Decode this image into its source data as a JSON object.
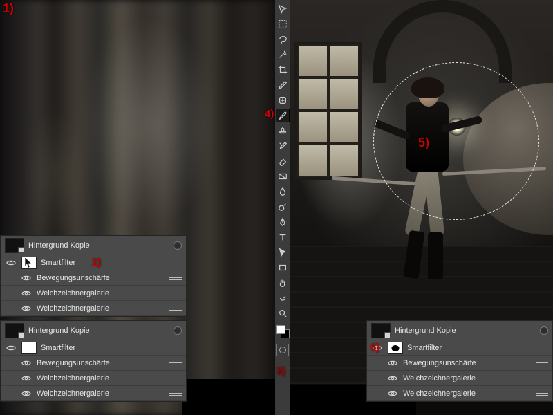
{
  "markers": {
    "m1": "1)",
    "m2": "2)",
    "m3": "3)",
    "m4": "4)",
    "m5": "5)",
    "m6": "6)"
  },
  "layerPanels": {
    "leftTop": {
      "header": "Hintergrund Kopie",
      "smartfilter": "Smartfilter",
      "filters": [
        "Bewegungsunschärfe",
        "Weichzeichnergalerie",
        "Weichzeichnergalerie"
      ]
    },
    "leftBottom": {
      "header": "Hintergrund Kopie",
      "smartfilter": "Smartfilter",
      "filters": [
        "Bewegungsunschärfe",
        "Weichzeichnergalerie",
        "Weichzeichnergalerie"
      ]
    },
    "right": {
      "header": "Hintergrund Kopie",
      "smartfilter": "Smartfilter",
      "filters": [
        "Bewegungsunschärfe",
        "Weichzeichnergalerie",
        "Weichzeichnergalerie"
      ]
    }
  },
  "tools": [
    {
      "name": "move-tool"
    },
    {
      "name": "marquee-tool"
    },
    {
      "name": "lasso-tool"
    },
    {
      "name": "magic-wand-tool"
    },
    {
      "name": "crop-tool"
    },
    {
      "name": "eyedropper-tool"
    },
    {
      "name": "healing-brush-tool"
    },
    {
      "name": "brush-tool",
      "active": true
    },
    {
      "name": "clone-stamp-tool"
    },
    {
      "name": "history-brush-tool"
    },
    {
      "name": "eraser-tool"
    },
    {
      "name": "gradient-tool"
    },
    {
      "name": "blur-tool"
    },
    {
      "name": "dodge-tool"
    },
    {
      "name": "pen-tool"
    },
    {
      "name": "type-tool"
    },
    {
      "name": "path-selection-tool"
    },
    {
      "name": "rectangle-shape-tool"
    },
    {
      "name": "hand-tool"
    },
    {
      "name": "rotate-view-tool"
    },
    {
      "name": "zoom-tool"
    }
  ]
}
